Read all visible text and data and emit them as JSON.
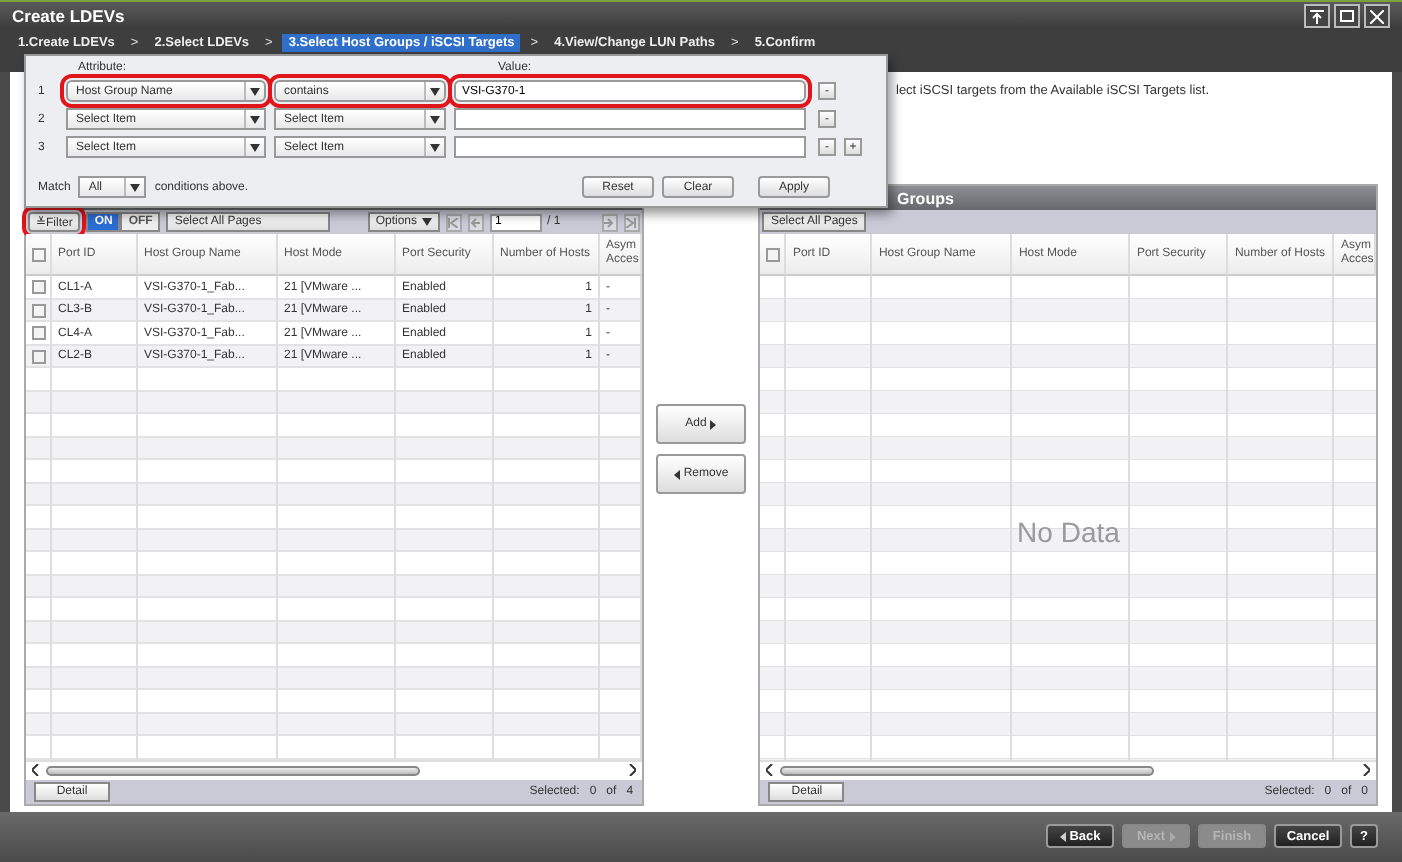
{
  "window": {
    "title": "Create LDEVs"
  },
  "steps": [
    {
      "label": "1.Create LDEVs",
      "kind": "step",
      "selected": false
    },
    {
      "label": ">",
      "kind": "sep"
    },
    {
      "label": "2.Select LDEVs",
      "kind": "step",
      "selected": false
    },
    {
      "label": ">",
      "kind": "sep"
    },
    {
      "label": "3.Select Host Groups / iSCSI Targets",
      "kind": "step",
      "selected": true
    },
    {
      "label": ">",
      "kind": "sep"
    },
    {
      "label": "4.View/Change LUN Paths",
      "kind": "step",
      "selected": false
    },
    {
      "label": ">",
      "kind": "sep"
    },
    {
      "label": "5.Confirm",
      "kind": "step",
      "selected": false
    }
  ],
  "instruction": "lect iSCSI targets from the Available iSCSI Targets list.",
  "filter_popup": {
    "attribute_label": "Attribute:",
    "value_label": "Value:",
    "rows": [
      {
        "number": "1",
        "attribute": "Host Group Name",
        "operator": "contains",
        "value": "VSI-G370-1",
        "highlighted": true,
        "remove": "-"
      },
      {
        "number": "2",
        "attribute": "Select Item",
        "operator": "Select Item",
        "highlighted": false,
        "remove": "-"
      },
      {
        "number": "3",
        "attribute": "Select Item",
        "operator": "Select Item",
        "highlighted": false,
        "remove": "-",
        "add": "+"
      }
    ],
    "match_label": "Match",
    "match_value": "All",
    "match_suffix": "conditions above.",
    "buttons": [
      "Reset",
      "Clear",
      "Apply"
    ]
  },
  "left_panel": {
    "select_all_checked": false,
    "filter_button": {
      "icon": "≚",
      "label": "Filter",
      "highlighted": true
    },
    "toggle": [
      {
        "label": "ON",
        "selected": true
      },
      {
        "label": "OFF",
        "selected": false
      }
    ],
    "select_all": "Select All Pages",
    "options": "Options",
    "page": "1",
    "page_total": "/ 1",
    "columns": [
      "Port ID",
      "Host Group Name",
      "Host Mode",
      "Port Security",
      "Number of Hosts",
      "Asym Acces"
    ],
    "rows": [
      {
        "cells": [
          "CL1-A",
          "VSI-G370-1_Fab...",
          "21 [VMware ...",
          "Enabled",
          "1",
          "-"
        ],
        "checked": false
      },
      {
        "cells": [
          "CL3-B",
          "VSI-G370-1_Fab...",
          "21 [VMware ...",
          "Enabled",
          "1",
          "-"
        ],
        "checked": false
      },
      {
        "cells": [
          "CL4-A",
          "VSI-G370-1_Fab...",
          "21 [VMware ...",
          "Enabled",
          "1",
          "-"
        ],
        "checked": false
      },
      {
        "cells": [
          "CL2-B",
          "VSI-G370-1_Fab...",
          "21 [VMware ...",
          "Enabled",
          "1",
          "-"
        ],
        "checked": false
      }
    ],
    "detail": "Detail",
    "selected_label": "Selected:",
    "selected_count": "0",
    "of": "of",
    "total": "4"
  },
  "transfer_buttons": [
    {
      "label": "Add",
      "kind": "add"
    },
    {
      "label": "Remove",
      "kind": "remove"
    }
  ],
  "right_panel": {
    "select_all_checked": false,
    "title": "Groups",
    "select_all": "Select All Pages",
    "columns": [
      "Port ID",
      "Host Group Name",
      "Host Mode",
      "Port Security",
      "Number of Hosts",
      "Asym Acces"
    ],
    "empty_text": "No Data",
    "detail": "Detail",
    "selected_label": "Selected:",
    "selected_count": "0",
    "of": "of",
    "total": "0"
  },
  "footer_buttons": [
    {
      "label": "Back",
      "kind": "back",
      "disabled": false
    },
    {
      "label": "Next",
      "kind": "next",
      "disabled": true
    },
    {
      "label": "Finish",
      "kind": "plain",
      "disabled": true
    },
    {
      "label": "Cancel",
      "kind": "plain",
      "disabled": false
    },
    {
      "label": "?",
      "kind": "help",
      "disabled": false
    }
  ]
}
